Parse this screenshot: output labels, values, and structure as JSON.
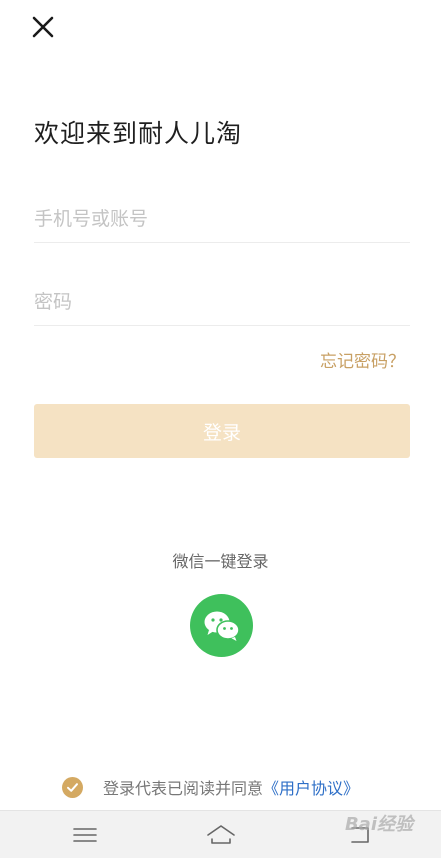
{
  "page": {
    "title": "欢迎来到耐人儿淘"
  },
  "form": {
    "phone_placeholder": "手机号或账号",
    "password_placeholder": "密码",
    "forgot_label": "忘记密码？",
    "login_label": "登录"
  },
  "social": {
    "wechat_label": "微信一键登录"
  },
  "agreement": {
    "prefix": "登录代表已阅读并同意",
    "link": "《用户协议》",
    "checked": true
  },
  "watermark": {
    "text": "Bai经验"
  },
  "icons": {
    "close": "close-icon",
    "wechat": "wechat-icon",
    "check": "check-icon",
    "menu": "menu-icon",
    "home": "home-icon",
    "back": "back-icon"
  },
  "colors": {
    "accent": "#c8a064",
    "login_button_disabled": "#f5e2c3",
    "wechat_green": "#3fc05c",
    "agreement_link": "#2e6fc7"
  }
}
